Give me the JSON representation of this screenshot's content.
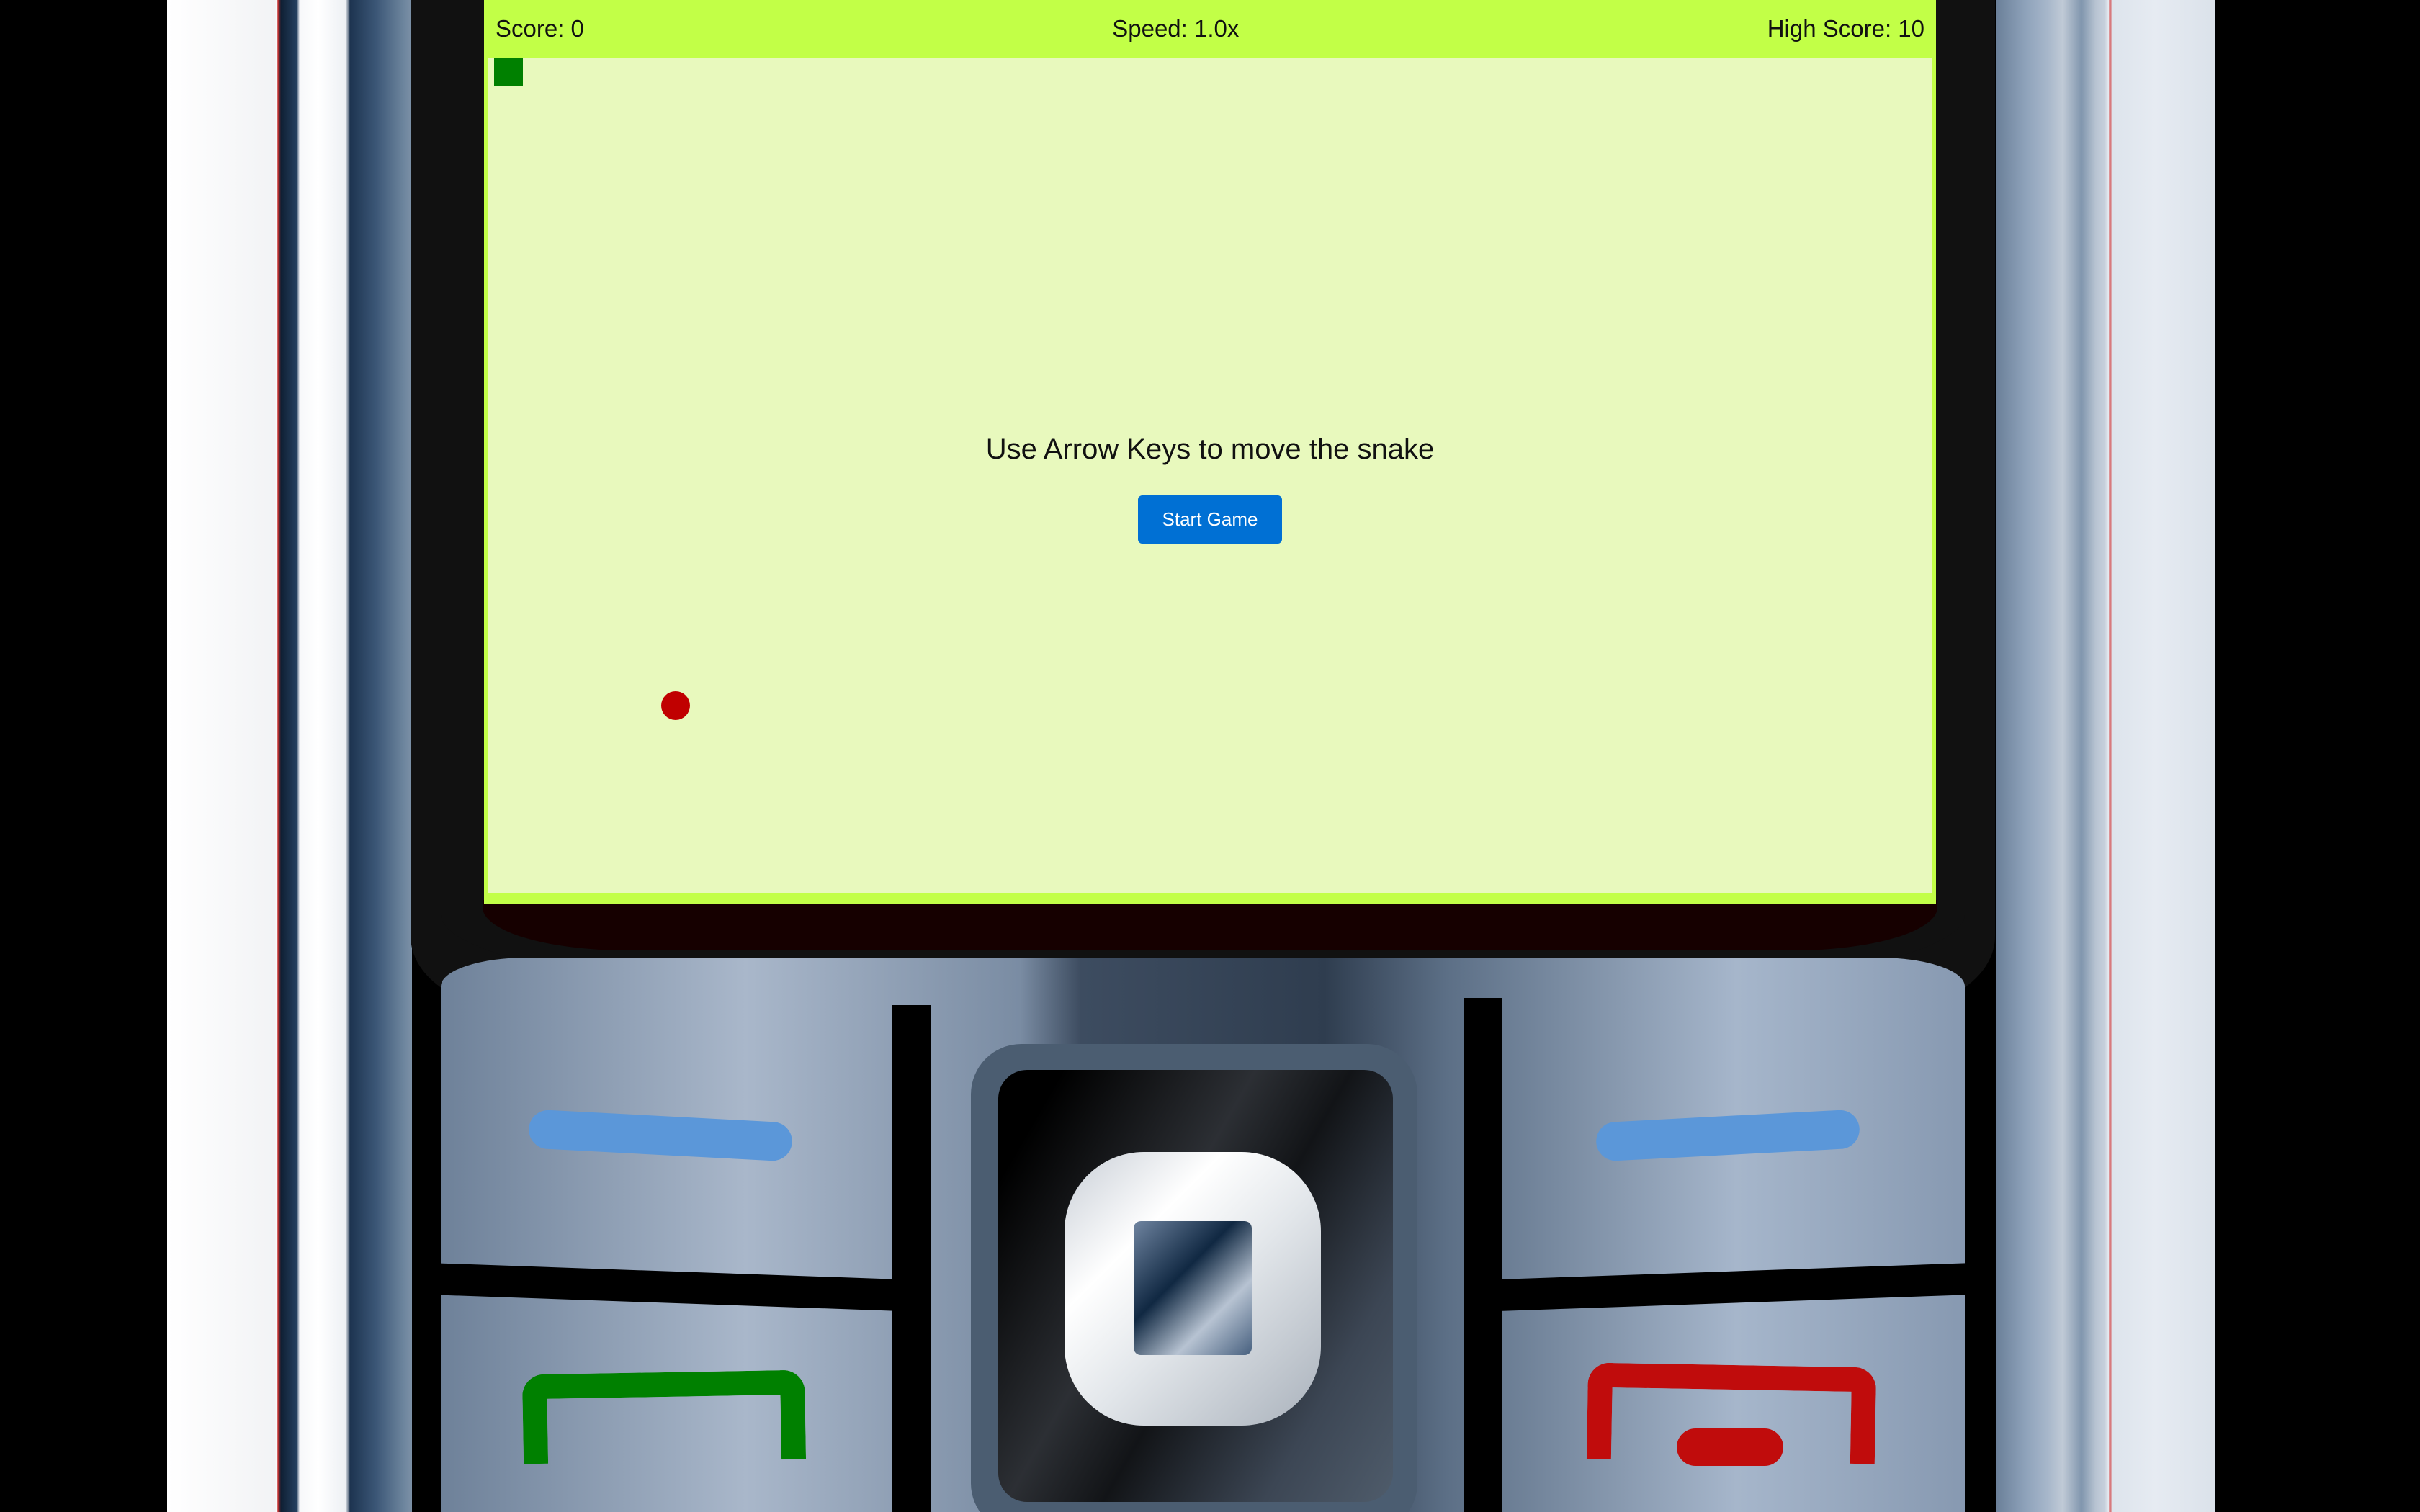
{
  "hud": {
    "score_label": "Score: 0",
    "speed_label": "Speed: 1.0x",
    "high_score_label": "High Score: 10"
  },
  "game": {
    "instruction": "Use Arrow Keys to move the snake",
    "start_button_label": "Start Game"
  },
  "colors": {
    "screen_bar": "#c2ff47",
    "playfield": "#e8f9bd",
    "snake": "#008000",
    "food": "#c00000",
    "button": "#0070d4",
    "softkey": "#5b97d9",
    "call_key": "#008000",
    "end_key": "#c00c0c"
  },
  "icons": {
    "left_softkey": "softkey-bar-icon",
    "right_softkey": "softkey-bar-icon",
    "call": "call-key-icon",
    "end": "end-key-icon",
    "select": "select-key-icon"
  }
}
